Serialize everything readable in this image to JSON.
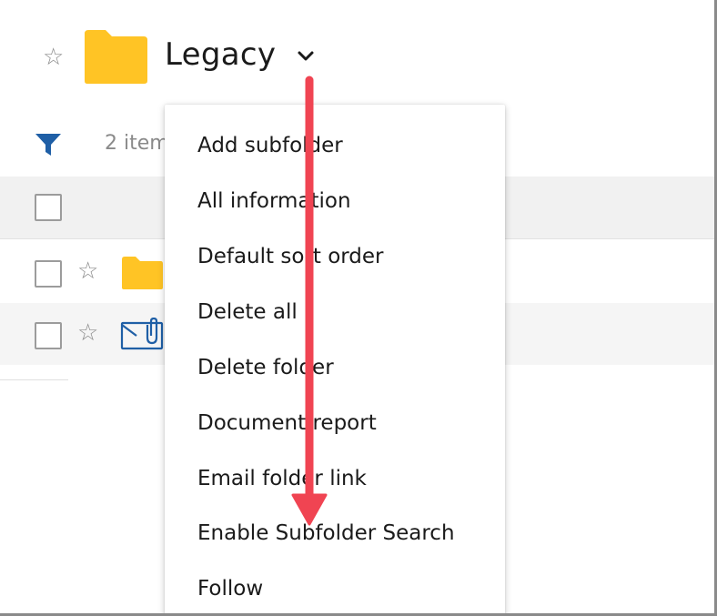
{
  "header": {
    "title": "Legacy",
    "favorite_icon": "star-outline-icon",
    "folder_icon": "folder-icon",
    "dropdown_icon": "chevron-down-icon"
  },
  "toolbar": {
    "filter_icon": "filter-icon",
    "item_count": "2 item"
  },
  "list": {
    "rows": [
      {
        "icon": "folder-icon",
        "favorite_icon": "star-outline-icon"
      },
      {
        "icon": "email-attachment-icon",
        "favorite_icon": "star-outline-icon"
      }
    ]
  },
  "menu": {
    "items": [
      "Add subfolder",
      "All information",
      "Default sort order",
      "Delete all",
      "Delete folder",
      "Document report",
      "Email folder link",
      "Enable Subfolder Search",
      "Follow"
    ]
  },
  "colors": {
    "folder": "#FFC425",
    "filter": "#1F5FA6",
    "annotation_arrow": "#F04452",
    "text": "#1A1A1A",
    "muted": "#8A8A8A"
  }
}
